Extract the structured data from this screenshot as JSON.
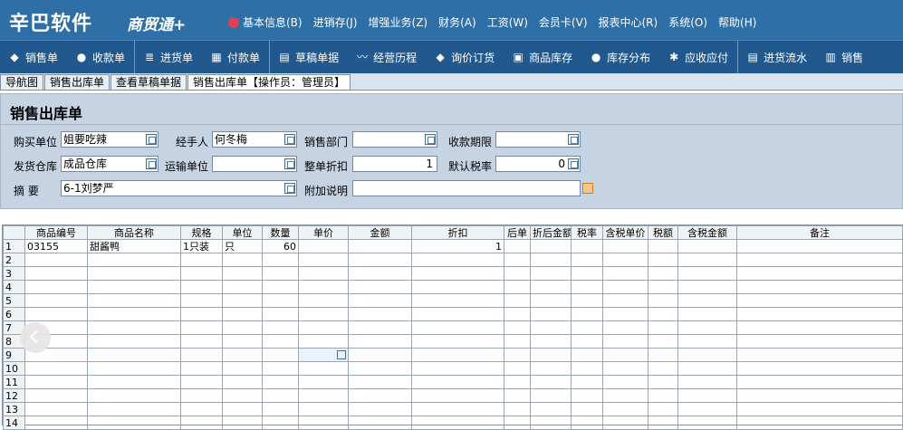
{
  "header": {
    "logo_text": "辛巴软件",
    "logo_sub": "商贸通+",
    "menus": [
      "基本信息(B)",
      "进销存(J)",
      "增强业务(Z)",
      "财务(A)",
      "工资(W)",
      "会员卡(V)",
      "报表中心(R)",
      "系统(O)",
      "帮助(H)"
    ]
  },
  "toolbar": {
    "items": [
      {
        "label": "销售单",
        "icon": "tag-icon"
      },
      {
        "label": "收款单",
        "icon": "user-icon"
      },
      {
        "label": "进货单",
        "icon": "list-icon"
      },
      {
        "label": "付款单",
        "icon": "calc-icon"
      },
      {
        "label": "草稿单据",
        "icon": "doc-icon"
      },
      {
        "label": "经营历程",
        "icon": "chart-icon"
      },
      {
        "label": "询价订货",
        "icon": "tag-icon"
      },
      {
        "label": "商品库存",
        "icon": "box-icon"
      },
      {
        "label": "库存分布",
        "icon": "user-icon"
      },
      {
        "label": "应收应付",
        "icon": "gear-icon"
      },
      {
        "label": "进货流水",
        "icon": "doc-icon"
      },
      {
        "label": "销售",
        "icon": "store-icon"
      }
    ]
  },
  "tabs": [
    "导航图",
    "销售出库单",
    "查看草稿单据",
    "销售出库单【操作员：管理员】"
  ],
  "form": {
    "title": "销售出库单",
    "buyer_label": "购买单位",
    "buyer_value": "姐要吃辣",
    "handler_label": "经手人",
    "handler_value": "何冬梅",
    "dept_label": "销售部门",
    "dept_value": "",
    "term_label": "收款期限",
    "term_value": "",
    "warehouse_label": "发货仓库",
    "warehouse_value": "成品仓库",
    "transport_label": "运输单位",
    "transport_value": "",
    "discount_label": "整单折扣",
    "discount_value": "1",
    "taxrate_label": "默认税率",
    "taxrate_value": "0",
    "summary_label": "摘    要",
    "summary_value": "6-1刘梦严",
    "note_label": "附加说明",
    "note_value": ""
  },
  "grid": {
    "columns": [
      "",
      "商品编号",
      "商品名称",
      "规格",
      "单位",
      "数量",
      "单价",
      "金额",
      "折扣",
      "后单",
      "折后金额",
      "税率",
      "含税单价",
      "税额",
      "含税金额",
      "备注"
    ],
    "rows": [
      [
        "1",
        "03155",
        "甜酱鸭",
        "1只装",
        "只",
        "60",
        "",
        "",
        "1",
        "",
        "",
        "",
        "",
        "",
        "",
        ""
      ],
      [
        "2",
        "",
        "",
        "",
        "",
        "",
        "",
        "",
        "",
        "",
        "",
        "",
        "",
        "",
        "",
        ""
      ],
      [
        "3",
        "",
        "",
        "",
        "",
        "",
        "",
        "",
        "",
        "",
        "",
        "",
        "",
        "",
        "",
        ""
      ],
      [
        "4",
        "",
        "",
        "",
        "",
        "",
        "",
        "",
        "",
        "",
        "",
        "",
        "",
        "",
        "",
        ""
      ],
      [
        "5",
        "",
        "",
        "",
        "",
        "",
        "",
        "",
        "",
        "",
        "",
        "",
        "",
        "",
        "",
        ""
      ],
      [
        "6",
        "",
        "",
        "",
        "",
        "",
        "",
        "",
        "",
        "",
        "",
        "",
        "",
        "",
        "",
        ""
      ],
      [
        "7",
        "",
        "",
        "",
        "",
        "",
        "",
        "",
        "",
        "",
        "",
        "",
        "",
        "",
        "",
        ""
      ],
      [
        "8",
        "",
        "",
        "",
        "",
        "",
        "",
        "",
        "",
        "",
        "",
        "",
        "",
        "",
        "",
        ""
      ],
      [
        "9",
        "",
        "",
        "",
        "",
        "",
        "",
        "",
        "",
        "",
        "",
        "",
        "",
        "",
        "",
        ""
      ],
      [
        "10",
        "",
        "",
        "",
        "",
        "",
        "",
        "",
        "",
        "",
        "",
        "",
        "",
        "",
        "",
        ""
      ],
      [
        "11",
        "",
        "",
        "",
        "",
        "",
        "",
        "",
        "",
        "",
        "",
        "",
        "",
        "",
        "",
        ""
      ],
      [
        "12",
        "",
        "",
        "",
        "",
        "",
        "",
        "",
        "",
        "",
        "",
        "",
        "",
        "",
        "",
        ""
      ],
      [
        "13",
        "",
        "",
        "",
        "",
        "",
        "",
        "",
        "",
        "",
        "",
        "",
        "",
        "",
        "",
        ""
      ],
      [
        "14",
        "",
        "",
        "",
        "",
        "",
        "",
        "",
        "",
        "",
        "",
        "",
        "",
        "",
        "",
        ""
      ]
    ]
  }
}
